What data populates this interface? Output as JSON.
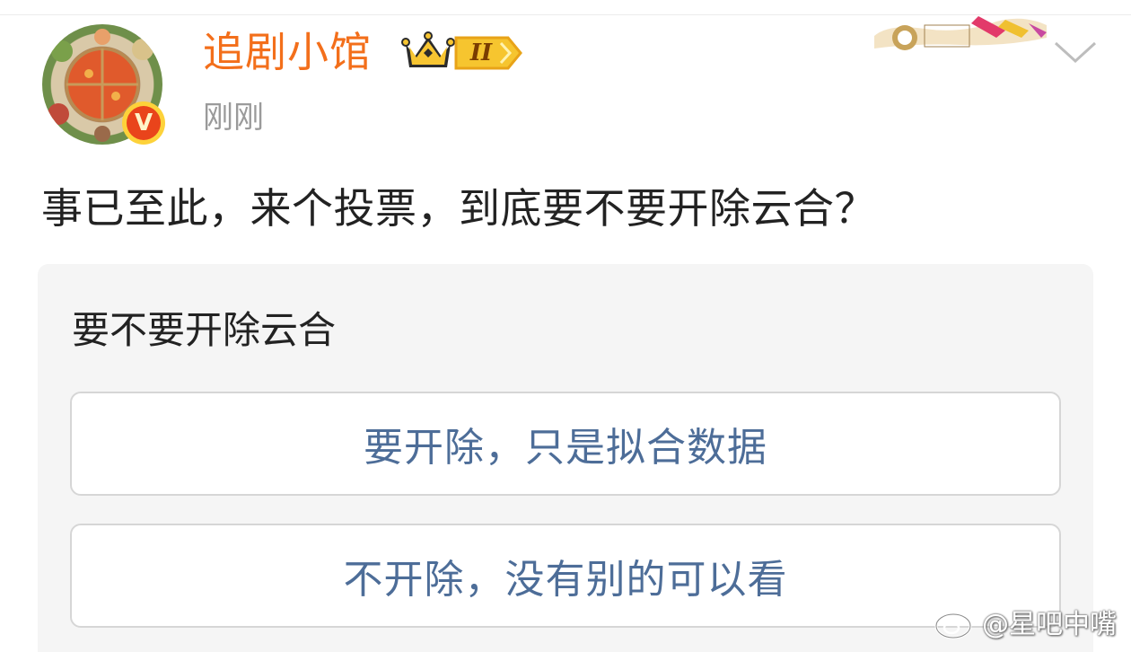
{
  "post": {
    "author": {
      "name": "追剧小馆",
      "level": "II",
      "verified_icon": "verified-v-icon"
    },
    "timestamp": "刚刚",
    "text": "事已至此，来个投票，到底要不要开除云合？"
  },
  "poll": {
    "title": "要不要开除云合",
    "options": [
      {
        "label": "要开除，只是拟合数据"
      },
      {
        "label": "不开除，没有别的可以看"
      }
    ]
  },
  "watermark": {
    "text": "@星吧中嘴"
  },
  "colors": {
    "username": "#f36f1b",
    "option_text": "#4d6d98",
    "poll_bg": "#f5f5f5",
    "timestamp": "#9a9a9a",
    "verified": "#e9441b"
  }
}
